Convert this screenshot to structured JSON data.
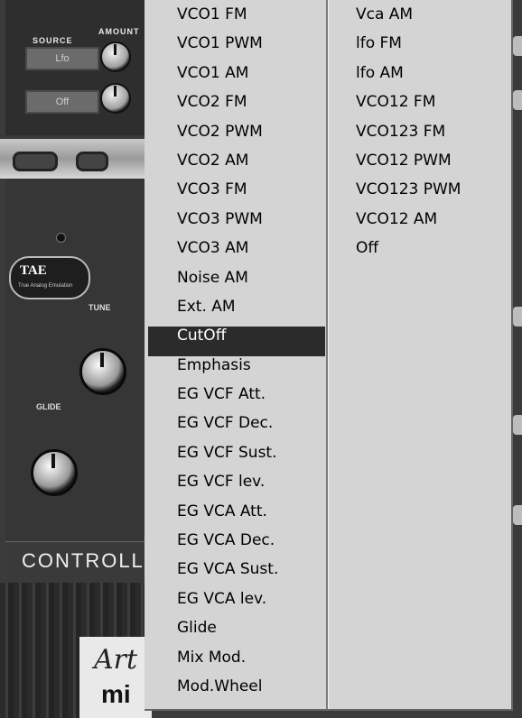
{
  "background": {
    "source_label": "SOURCE",
    "amount_label": "AMOUNT",
    "source_value_1": "Lfo",
    "source_value_2": "Off",
    "tae_label": "TAE",
    "tae_subtitle": "True Analog Emulation",
    "tune_label": "TUNE",
    "glide_label": "GLIDE",
    "controllers_label": "CONTROLL",
    "logo_script": "Art",
    "logo_text": "mi"
  },
  "menu": {
    "column1": [
      "VCO1 FM",
      "VCO1 PWM",
      "VCO1 AM",
      "VCO2 FM",
      "VCO2 PWM",
      "VCO2 AM",
      "VCO3 FM",
      "VCO3 PWM",
      "VCO3 AM",
      "Noise AM",
      "Ext. AM",
      "CutOff",
      "Emphasis",
      "EG VCF Att.",
      "EG VCF Dec.",
      "EG VCF Sust.",
      "EG VCF lev.",
      "EG VCA Att.",
      "EG VCA Dec.",
      "EG VCA Sust.",
      "EG VCA lev.",
      "Glide",
      "Mix Mod.",
      "Mod.Wheel"
    ],
    "column2": [
      "Vca AM",
      "lfo FM",
      "lfo AM",
      "VCO12 FM",
      "VCO123 FM",
      "VCO12 PWM",
      "VCO123 PWM",
      "VCO12 AM",
      "Off"
    ],
    "selected_item": "CutOff"
  },
  "colors": {
    "menu_bg": "#d4d4d4",
    "selection_bg": "#2b2b2b",
    "selection_fg": "#ffffff"
  }
}
